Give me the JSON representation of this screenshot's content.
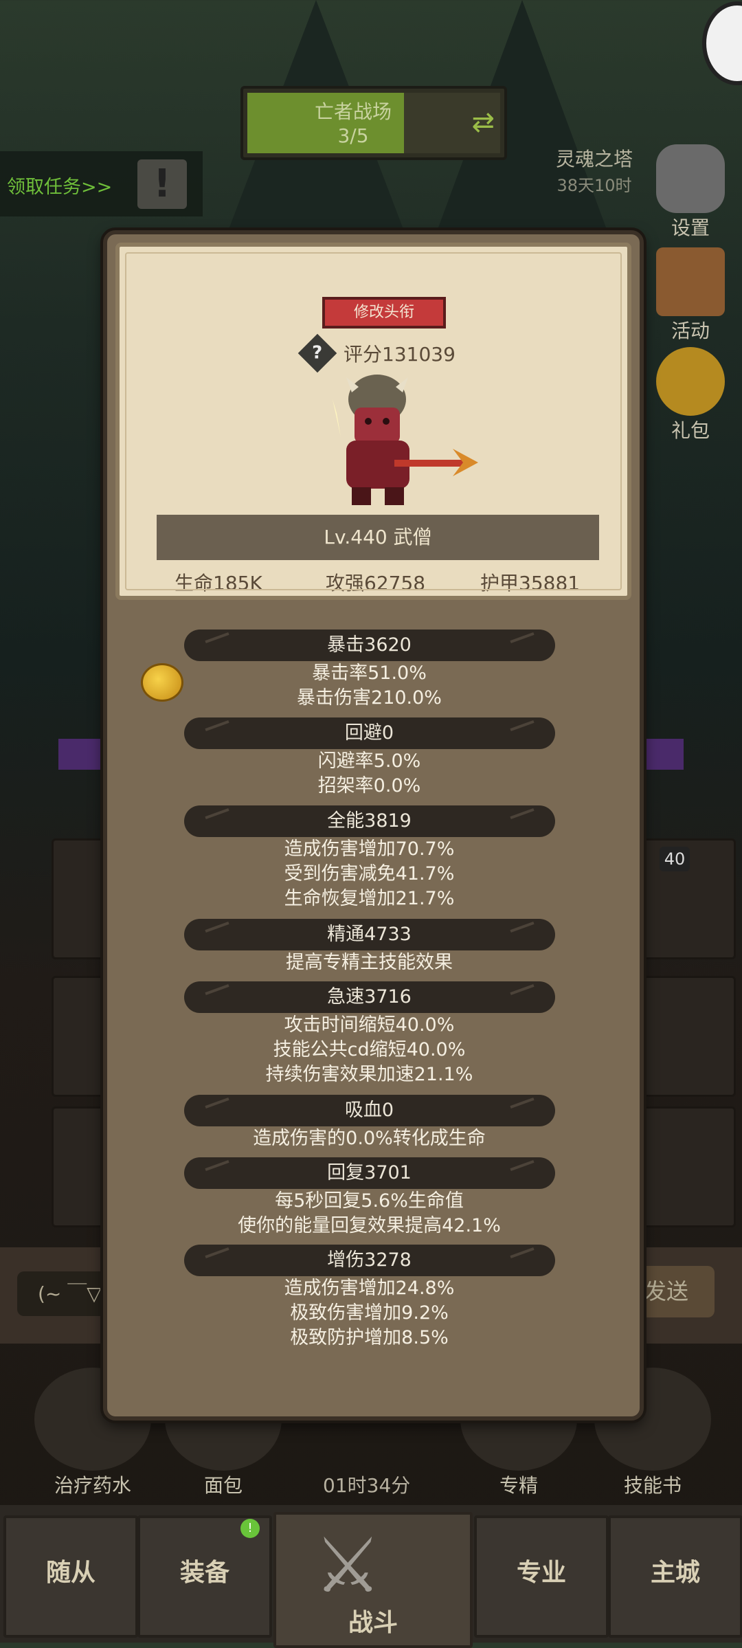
{
  "background": {
    "banner": {
      "title": "亡者战场",
      "progress_text": "3/5"
    },
    "task_link": "领取任务>>",
    "tower": {
      "label": "灵魂之塔",
      "sub": "38天10时"
    },
    "right_icons": [
      {
        "label": "设置",
        "icon": "gear-icon"
      },
      {
        "label": "活动",
        "icon": "scroll-icon"
      },
      {
        "label": "礼包",
        "icon": "gift-coin-icon"
      }
    ],
    "slot_badge": "40",
    "input_placeholder": "(~ ￣▽",
    "send_label": "发送",
    "consumables": [
      "治疗药水",
      "面包",
      "专精",
      "技能书"
    ],
    "timer": "01时34分",
    "nav": {
      "followers": "随从",
      "equipment": "装备",
      "battle": "战斗",
      "profession": "专业",
      "city": "主城"
    }
  },
  "card": {
    "change_title_button": "修改头衔",
    "rating": "评分131039",
    "level_class": "Lv.440 武僧",
    "hp": "生命185K",
    "attack": "攻强62758",
    "armor": "护甲35881"
  },
  "sections": [
    {
      "header": "暴击3620",
      "lines": [
        "暴击率51.0%",
        "暴击伤害210.0%"
      ]
    },
    {
      "header": "回避0",
      "lines": [
        "闪避率5.0%",
        "招架率0.0%"
      ]
    },
    {
      "header": "全能3819",
      "lines": [
        "造成伤害增加70.7%",
        "受到伤害减免41.7%",
        "生命恢复增加21.7%"
      ]
    },
    {
      "header": "精通4733",
      "lines": [
        "提高专精主技能效果"
      ]
    },
    {
      "header": "急速3716",
      "lines": [
        "攻击时间缩短40.0%",
        "技能公共cd缩短40.0%",
        "持续伤害效果加速21.1%"
      ]
    },
    {
      "header": "吸血0",
      "lines": [
        "造成伤害的0.0%转化成生命"
      ]
    },
    {
      "header": "回复3701",
      "lines": [
        "每5秒回复5.6%生命值",
        "使你的能量回复效果提高42.1%"
      ]
    },
    {
      "header": "增伤3278",
      "lines": [
        "造成伤害增加24.8%",
        "极致伤害增加9.2%",
        "极致防护增加8.5%"
      ]
    }
  ]
}
